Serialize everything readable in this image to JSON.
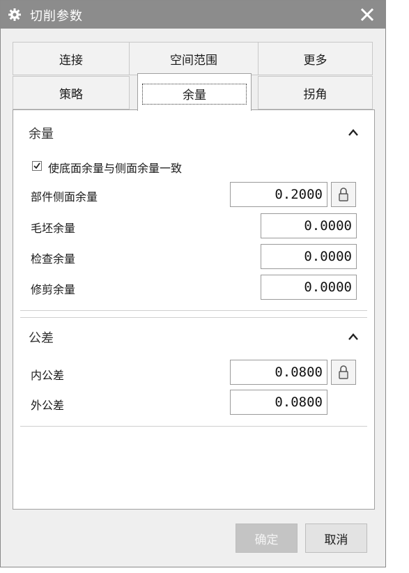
{
  "dialog": {
    "title": "切削参数",
    "close_glyph": "✕",
    "icon": "gear-icon"
  },
  "tabs": {
    "row1": [
      "连接",
      "空间范围",
      "更多"
    ],
    "row2": [
      "策略",
      "余量",
      "拐角"
    ],
    "active": "余量"
  },
  "stock": {
    "title": "余量",
    "collapse_icon": "chevron-up-icon",
    "checkbox_label": "使底面余量与侧面余量一致",
    "checkbox_checked": true,
    "rows": [
      {
        "label": "部件侧面余量",
        "value": "0.2000",
        "locked": true
      },
      {
        "label": "毛坯余量",
        "value": "0.0000"
      },
      {
        "label": "检查余量",
        "value": "0.0000"
      },
      {
        "label": "修剪余量",
        "value": "0.0000"
      }
    ]
  },
  "tolerance": {
    "title": "公差",
    "collapse_icon": "chevron-up-icon",
    "rows": [
      {
        "label": "内公差",
        "value": "0.0800",
        "locked": true
      },
      {
        "label": "外公差",
        "value": "0.0800"
      }
    ]
  },
  "buttons": {
    "ok": "确定",
    "cancel": "取消"
  }
}
